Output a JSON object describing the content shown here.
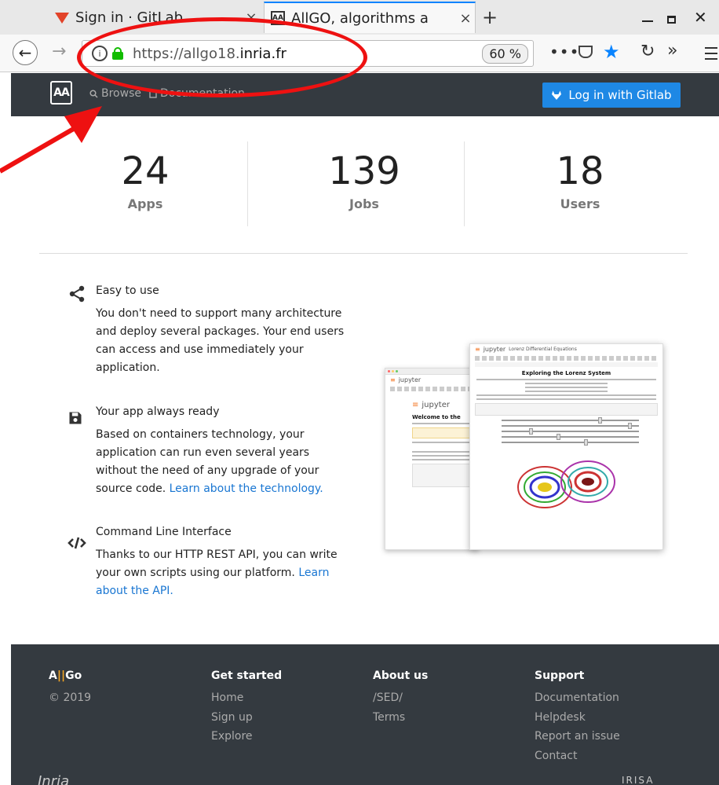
{
  "browser": {
    "tabs": [
      {
        "label": "Sign in · GitLab",
        "icon": "gitlab-icon"
      },
      {
        "label": "AllGO, algorithms a",
        "icon": "allgo-icon"
      }
    ],
    "url_prefix": "https://allgo18.",
    "url_domain": "inria.fr",
    "zoom": "60 %",
    "close_glyph": "×",
    "new_tab_glyph": "+"
  },
  "site": {
    "logo_text": "AA",
    "nav": [
      {
        "label": "Browse",
        "icon": "search-icon"
      },
      {
        "label": "Documentation",
        "icon": "book-icon"
      }
    ],
    "login_label": "Log in with Gitlab"
  },
  "stats": [
    {
      "value": "24",
      "label": "Apps"
    },
    {
      "value": "139",
      "label": "Jobs"
    },
    {
      "value": "18",
      "label": "Users"
    }
  ],
  "features": [
    {
      "title": "Easy to use",
      "icon": "share-icon",
      "text": "You don't need to support many architecture and deploy several packages. Your end users can access and use immediately your application."
    },
    {
      "title": "Your app always ready",
      "icon": "floppy-icon",
      "text": "Based on containers technology, your application can run even several years without the need of any upgrade of your source code. ",
      "link": "Learn about the technology."
    },
    {
      "title": "Command Line Interface",
      "icon": "code-icon",
      "text": "Thanks to our HTTP REST API, you can write your own scripts using our platform. ",
      "link": "Learn about the API."
    }
  ],
  "illustration": {
    "back_app": "jupyter",
    "back_heading": "Welcome to the",
    "front_app": "jupyter",
    "front_title": "Lorenz Differential Equations",
    "front_heading": "Exploring the Lorenz System"
  },
  "footer": {
    "brand_a": "A",
    "brand_bar": "||",
    "brand_go": "Go",
    "copyright": "© 2019",
    "columns": [
      {
        "title": "Get started",
        "links": [
          "Home",
          "Sign up",
          "Explore"
        ]
      },
      {
        "title": "About us",
        "links": [
          "/SED/",
          "Terms"
        ]
      },
      {
        "title": "Support",
        "links": [
          "Documentation",
          "Helpdesk",
          "Report an issue",
          "Contact"
        ]
      }
    ],
    "inria": "Inria",
    "irisa": "IRISA"
  },
  "colors": {
    "header_bg": "#343a40",
    "login_button": "#1e88e5",
    "link": "#1976d2",
    "annotation": "#ee1111"
  }
}
